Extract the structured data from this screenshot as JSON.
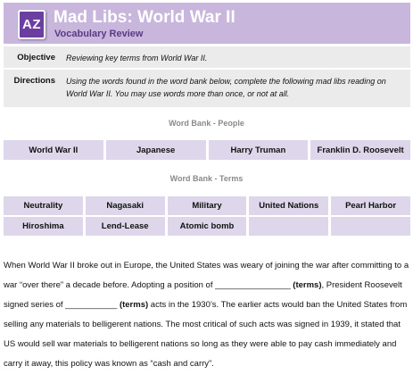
{
  "header": {
    "logo_text": "AZ",
    "title": "Mad Libs: World War II",
    "subtitle": "Vocabulary Review",
    "bg_color": "#c9b6dc",
    "logo_color": "#6a3fa0"
  },
  "objective": {
    "label": "Objective",
    "text": "Reviewing key terms from World War II."
  },
  "directions": {
    "label": "Directions",
    "text": "Using the words found in the word bank below, complete the following mad libs reading on World War II.  You may use words more than once, or not at all."
  },
  "word_bank_people": {
    "title": "Word Bank - People",
    "words": [
      "World War II",
      "Japanese",
      "Harry Truman",
      "Franklin D. Roosevelt"
    ]
  },
  "word_bank_terms": {
    "title": "Word Bank - Terms",
    "row1": [
      "Neutrality",
      "Nagasaki",
      "Military",
      "United Nations",
      "Pearl Harbor"
    ],
    "row2": [
      "Hiroshima",
      "Lend-Lease",
      "Atomic bomb",
      "",
      ""
    ]
  },
  "passage": {
    "p1": "When World War II broke out in Europe, the United States was weary of joining the war after committing to a war “over there” a decade before.  Adopting a position of ________________ ",
    "term1": "(terms)",
    "p2": ", President Roosevelt signed series of ___________ ",
    "term2": "(terms)",
    "p3": " acts in the 1930’s.  The earlier acts would ban the United States from selling any materials to belligerent nations.  The most critical of such acts was signed in 1939, it stated that US would sell war materials to belligerent nations so long as they were able to pay cash immediately and carry it away, this policy was known as “cash and carry”."
  }
}
